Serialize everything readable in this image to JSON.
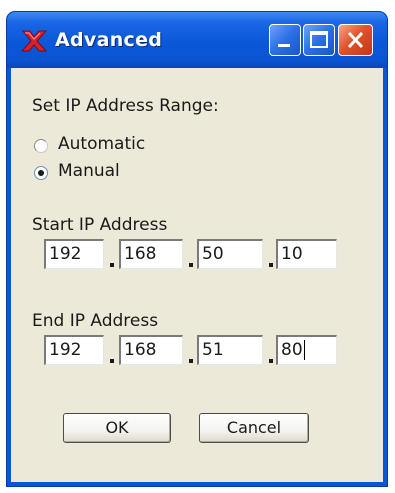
{
  "window": {
    "title": "Advanced"
  },
  "range": {
    "heading": "Set IP Address Range:",
    "options": [
      {
        "label": "Automatic",
        "checked": false
      },
      {
        "label": "Manual",
        "checked": true
      }
    ]
  },
  "start": {
    "label": "Start IP Address",
    "octets": [
      "192",
      "168",
      "50",
      "10"
    ]
  },
  "end": {
    "label": "End IP Address",
    "octets": [
      "192",
      "168",
      "51",
      "80"
    ]
  },
  "buttons": {
    "ok": "OK",
    "cancel": "Cancel"
  },
  "colors": {
    "titlebar": "#0a58d8",
    "client": "#ece9d8",
    "close": "#e0532b"
  },
  "icons": {
    "app": "red-x-app-icon",
    "minimize": "minimize-icon",
    "maximize": "maximize-icon",
    "close": "close-icon"
  }
}
